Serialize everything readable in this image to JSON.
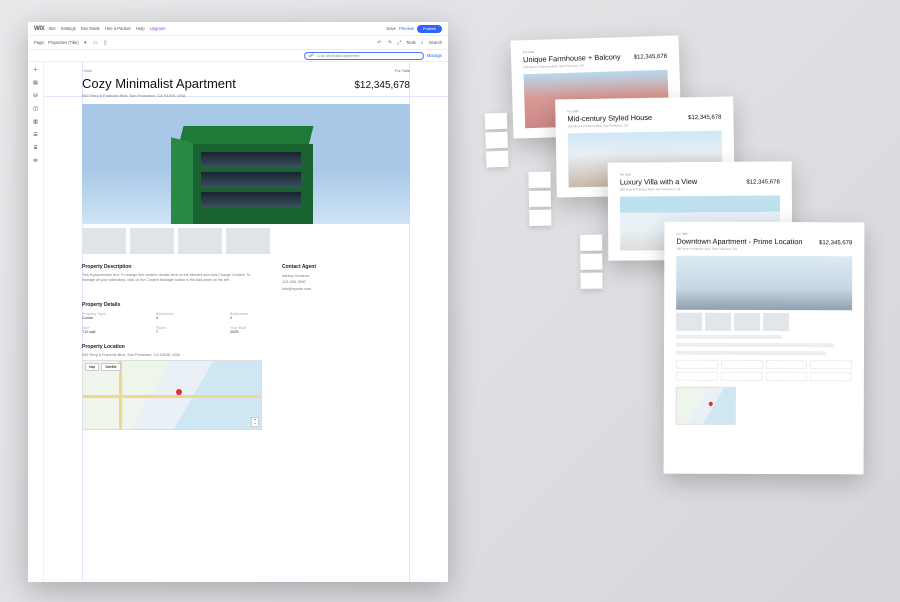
{
  "topbar": {
    "logo": "WIX",
    "menu": [
      "Site",
      "Settings",
      "Dev Mode",
      "Hire a Partner",
      "Help"
    ],
    "upgrade": "Upgrade",
    "save": "Save",
    "preview": "Preview",
    "publish": "Publish"
  },
  "secondbar": {
    "page_label": "Page:",
    "page_name": "Properties (Title)",
    "tools": "Tools",
    "search": "Search"
  },
  "thirdbar": {
    "search_value": "Cozy Minimalist Apartment",
    "manage": "Manage"
  },
  "siderail_icons": [
    "plus-icon",
    "layers-icon",
    "database-icon",
    "apps-icon",
    "media-icon",
    "bookmarks-icon",
    "cms-icon",
    "chat-icon"
  ],
  "listing": {
    "back": "‹ Back",
    "title": "Cozy Minimalist Apartment",
    "address": "500 Terry A Francois Blvd, San Francisco, CA 94158, USA",
    "status": "For Sale",
    "price": "$12,345,678",
    "desc_h": "Property Description",
    "desc": "This is placeholder text. To change this content, double-click on the element and click Change Content. To manage all your collections, click on the Content Manager button in the Add panel on the left.",
    "contact_h": "Contact Agent",
    "agent_name": "Ashley Johnson",
    "agent_phone": "123-456-7890",
    "agent_email": "info@mysite.com",
    "details_h": "Property Details",
    "details": [
      {
        "lab": "Property Type",
        "val": "Condo"
      },
      {
        "lab": "Bedrooms",
        "val": "4"
      },
      {
        "lab": "Bathrooms",
        "val": "2"
      },
      {
        "lab": "Size",
        "val": "710 sqft"
      },
      {
        "lab": "Floors",
        "val": "7"
      },
      {
        "lab": "Year Built",
        "val": "2005"
      }
    ],
    "location_h": "Property Location",
    "location_addr": "500 Terry A Francois Blvd, San Francisco, CA 94158, USA",
    "map_tabs": [
      "Map",
      "Satellite"
    ]
  },
  "stack": [
    {
      "status": "For Sale",
      "title": "Unique Farmhouse + Balcony",
      "addr": "500 Terry A Francois Blvd, San Francisco, CA",
      "price": "$12,345,678"
    },
    {
      "status": "For Sale",
      "title": "Mid-century Styled House",
      "addr": "500 Terry A Francois Blvd, San Francisco, CA",
      "price": "$12,345,678"
    },
    {
      "status": "For Sale",
      "title": "Luxury Villa with a View",
      "addr": "500 Terry A Francois Blvd, San Francisco, CA",
      "price": "$12,345,678"
    },
    {
      "status": "For Sale",
      "title": "Downtown Apartment - Prime Location",
      "addr": "500 Terry A Francois Blvd, San Francisco, CA",
      "price": "$12,345,678"
    }
  ]
}
